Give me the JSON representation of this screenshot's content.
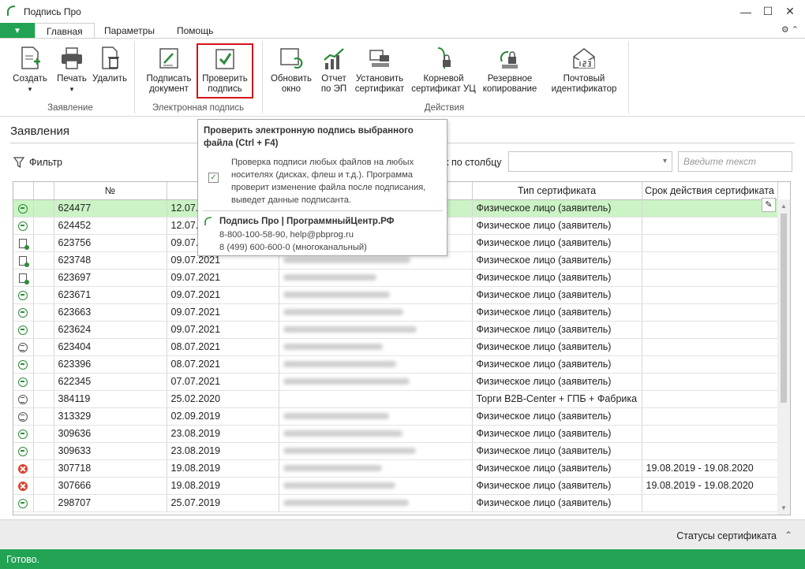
{
  "window": {
    "title": "Подпись Про",
    "controls": {
      "minimize": "—",
      "maximize": "☐",
      "close": "✕"
    }
  },
  "ribbon_tabs": {
    "menu_arrow": "▼",
    "tabs": [
      "Главная",
      "Параметры",
      "Помощь"
    ],
    "active": "Главная",
    "tools": "⚙ ⌃"
  },
  "ribbon": {
    "groups": [
      {
        "label": "Заявление",
        "buttons": [
          {
            "label": "Создать",
            "icon": "create-icon"
          },
          {
            "label": "Печать",
            "icon": "print-icon"
          },
          {
            "label": "Удалить",
            "icon": "delete-icon"
          }
        ]
      },
      {
        "label": "Электронная подпись",
        "buttons": [
          {
            "label": "Подписать документ",
            "icon": "sign-document-icon"
          },
          {
            "label": "Проверить подпись",
            "icon": "check-signature-icon"
          }
        ]
      },
      {
        "label": "Действия",
        "buttons": [
          {
            "label": "Обновить окно",
            "icon": "refresh-icon"
          },
          {
            "label": "Отчет по ЭП",
            "icon": "report-chart-icon"
          },
          {
            "label": "Установить сертификат",
            "icon": "install-certificate-icon"
          },
          {
            "label": "Корневой сертификат УЦ",
            "icon": "root-certificate-icon"
          },
          {
            "label": "Резервное копирование",
            "icon": "backup-icon"
          },
          {
            "label": "Почтовый идентификатор",
            "icon": "postal-id-icon"
          }
        ]
      }
    ],
    "split_arrow": "▾"
  },
  "page": {
    "title": "Заявления",
    "filter_label": "Фильтр",
    "search_by_column_label": "к по столбцу",
    "search_placeholder": "Введите текст"
  },
  "table": {
    "columns": [
      "№",
      "",
      "",
      "Тип сертификата",
      "Срок действия сертификата"
    ],
    "rows": [
      {
        "status": "green",
        "num": "624477",
        "date": "12.07.",
        "name_blur": true,
        "type": "Физическое лицо (заявитель)",
        "validity": "",
        "selected": true
      },
      {
        "status": "green",
        "num": "624452",
        "date": "12.07.",
        "name_blur": true,
        "type": "Физическое лицо (заявитель)",
        "validity": ""
      },
      {
        "status": "doc",
        "num": "623756",
        "date": "09.07.",
        "name_blur": true,
        "type": "Физическое лицо (заявитель)",
        "validity": ""
      },
      {
        "status": "doc",
        "num": "623748",
        "date": "09.07.2021",
        "name_blur": true,
        "type": "Физическое лицо (заявитель)",
        "validity": ""
      },
      {
        "status": "doc",
        "num": "623697",
        "date": "09.07.2021",
        "name_blur": true,
        "type": "Физическое лицо (заявитель)",
        "validity": ""
      },
      {
        "status": "green",
        "num": "623671",
        "date": "09.07.2021",
        "name_blur": true,
        "type": "Физическое лицо (заявитель)",
        "validity": ""
      },
      {
        "status": "green",
        "num": "623663",
        "date": "09.07.2021",
        "name_blur": true,
        "type": "Физическое лицо (заявитель)",
        "validity": ""
      },
      {
        "status": "green",
        "num": "623624",
        "date": "09.07.2021",
        "name_blur": true,
        "type": "Физическое лицо (заявитель)",
        "validity": ""
      },
      {
        "status": "list",
        "num": "623404",
        "date": "08.07.2021",
        "name_blur": true,
        "type": "Физическое лицо (заявитель)",
        "validity": ""
      },
      {
        "status": "green",
        "num": "623396",
        "date": "08.07.2021",
        "name_blur": true,
        "type": "Физическое лицо (заявитель)",
        "validity": ""
      },
      {
        "status": "green",
        "num": "622345",
        "date": "07.07.2021",
        "name_blur": true,
        "type": "Физическое лицо (заявитель)",
        "validity": ""
      },
      {
        "status": "list",
        "num": "384119",
        "date": "25.02.2020",
        "name_blur": false,
        "type": "Торги B2B-Center + ГПБ + Фабрика",
        "validity": ""
      },
      {
        "status": "list",
        "num": "313329",
        "date": "02.09.2019",
        "name_blur": true,
        "type": "Физическое лицо (заявитель)",
        "validity": ""
      },
      {
        "status": "green",
        "num": "309636",
        "date": "23.08.2019",
        "name_blur": true,
        "type": "Физическое лицо (заявитель)",
        "validity": ""
      },
      {
        "status": "green",
        "num": "309633",
        "date": "23.08.2019",
        "name_blur": true,
        "type": "Физическое лицо (заявитель)",
        "validity": ""
      },
      {
        "status": "red",
        "num": "307718",
        "date": "19.08.2019",
        "name_blur": true,
        "type": "Физическое лицо (заявитель)",
        "validity": "19.08.2019 - 19.08.2020"
      },
      {
        "status": "red",
        "num": "307666",
        "date": "19.08.2019",
        "name_blur": true,
        "type": "Физическое лицо (заявитель)",
        "validity": "19.08.2019 - 19.08.2020"
      },
      {
        "status": "green",
        "num": "298707",
        "date": "25.07.2019",
        "name_blur": true,
        "type": "Физическое лицо (заявитель)",
        "validity": ""
      }
    ]
  },
  "tooltip": {
    "title": "Проверить электронную подпись выбранного файла (Ctrl + F4)",
    "body": "Проверка подписи любых файлов на любых носителях (дисках, флеш и т.д.). Программа проверит изменение файла после подписания, выведет данные подписанта.",
    "company": "Подпись Про | ПрограммныйЦентр.РФ",
    "contacts": "8-800-100-58-90, help@pbprog.ru",
    "phone": "8 (499) 600-600-0 (многоканальный)"
  },
  "bottom": {
    "cert_statuses": "Статусы сертификата",
    "chevron": "⌃"
  },
  "status_bar": {
    "text": "Готово."
  },
  "colors": {
    "accent": "#22a353",
    "selected_row": "#cbf3c5",
    "highlight_border": "#d6121b",
    "error": "#d9432f"
  }
}
